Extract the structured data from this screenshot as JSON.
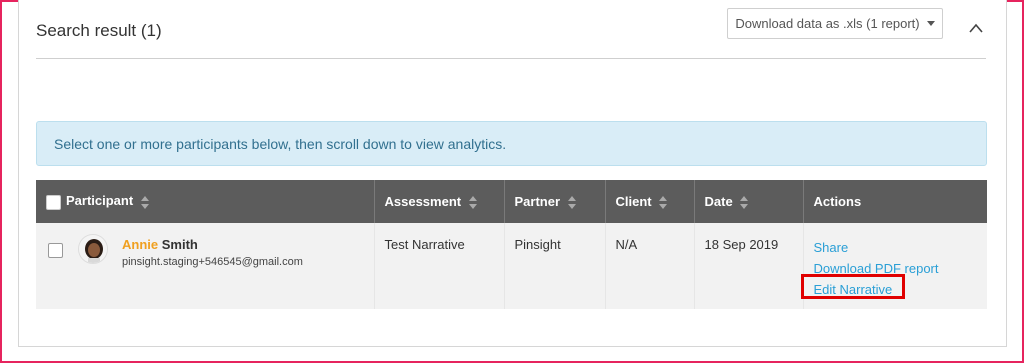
{
  "panel": {
    "title": "Search result (1)",
    "download_label": "Download data as .xls (1 report)"
  },
  "info_message": "Select one or more participants below, then scroll down to view analytics.",
  "table": {
    "headers": {
      "participant": "Participant",
      "assessment": "Assessment",
      "partner": "Partner",
      "client": "Client",
      "date": "Date",
      "actions": "Actions"
    },
    "rows": [
      {
        "first_name": "Annie",
        "last_name": "Smith",
        "email": "pinsight.staging+546545@gmail.com",
        "assessment": "Test Narrative",
        "partner": "Pinsight",
        "client": "N/A",
        "date": "18 Sep 2019",
        "actions": {
          "share": "Share",
          "download_pdf": "Download PDF report",
          "edit_narrative": "Edit Narrative"
        }
      }
    ]
  },
  "colors": {
    "frame_border": "#e6245e",
    "header_bg": "#5c5c5c",
    "info_bg": "#d9edf7",
    "info_text": "#31708f",
    "link": "#2a9fd6",
    "first_name": "#f0a020",
    "highlight": "#e00000"
  },
  "icons": {
    "collapse": "chevron-up-icon",
    "dropdown": "caret-down-icon",
    "sort": "sort-icon",
    "avatar": "avatar"
  }
}
